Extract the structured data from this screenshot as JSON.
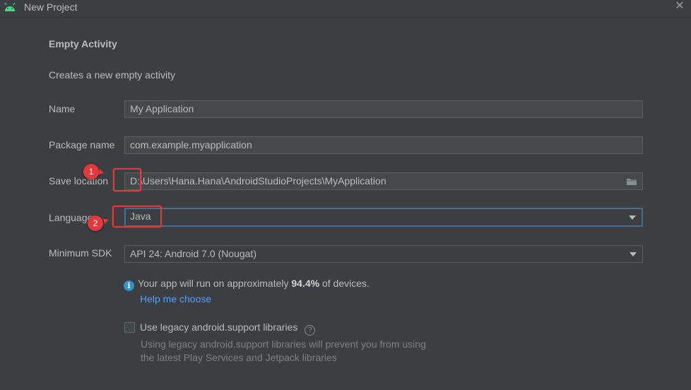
{
  "window": {
    "title": "New Project",
    "close_glyph": "✕",
    "app_icon": "android-icon"
  },
  "page": {
    "heading": "Empty Activity",
    "description": "Creates a new empty activity"
  },
  "form": {
    "name": {
      "label": "Name",
      "value": "My Application"
    },
    "package": {
      "label": "Package name",
      "value": "com.example.myapplication"
    },
    "save_location": {
      "label": "Save location",
      "value": "D:\\Users\\Hana.Hana\\AndroidStudioProjects\\MyApplication",
      "icon": "folder-icon"
    },
    "language": {
      "label": "Language",
      "value": "Java"
    },
    "min_sdk": {
      "label": "Minimum SDK",
      "value": "API 24: Android 7.0 (Nougat)"
    }
  },
  "info": {
    "icon": "info-icon",
    "text_before": "Your app will run on approximately ",
    "percent": "94.4%",
    "text_after": " of devices.",
    "help_link": "Help me choose"
  },
  "legacy": {
    "label": "Use legacy android.support libraries",
    "checked": false,
    "help_glyph": "?",
    "hint_line1": "Using legacy android.support libraries will prevent you from using",
    "hint_line2": "the latest Play Services and Jetpack libraries"
  },
  "annotations": [
    {
      "number": "1"
    },
    {
      "number": "2"
    }
  ],
  "colors": {
    "background": "#3c3f41",
    "field_bg": "#45494a",
    "focus_border": "#466d94",
    "link": "#589df6",
    "annotation_red": "#e0393e",
    "info_blue": "#3592c4"
  }
}
